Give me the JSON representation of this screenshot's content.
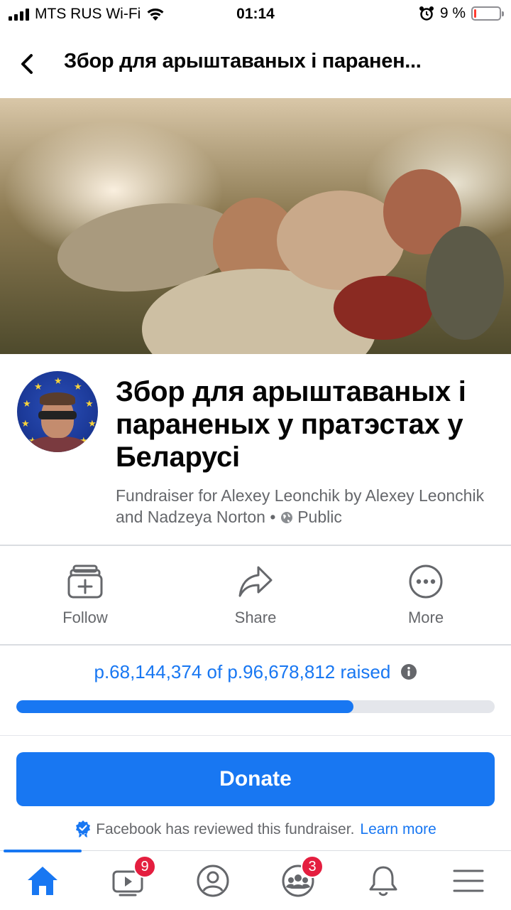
{
  "status_bar": {
    "carrier": "MTS RUS Wi-Fi",
    "time": "01:14",
    "battery_text": "9 %",
    "battery_level": 0.09
  },
  "header": {
    "title": "Збор для арыштаваных і паранен..."
  },
  "fundraiser": {
    "title": "Збор для арыштаваных і параненых у пратэстах у Беларусі",
    "subtitle": "Fundraiser for Alexey Leonchik by Alexey Leonchik and Nadzeya Norton •",
    "privacy": "Public"
  },
  "actions": {
    "follow": "Follow",
    "share": "Share",
    "more": "More"
  },
  "progress": {
    "raised_text": "р.68,144,374 of р.96,678,812 raised",
    "raised_amount": 68144374,
    "goal_amount": 96678812,
    "fraction": 0.7049
  },
  "donate": {
    "button_label": "Donate",
    "reviewed_text": "Facebook has reviewed this fundraiser.",
    "learn_more": "Learn more"
  },
  "tabbar": {
    "items": [
      {
        "icon": "home-icon",
        "active": true
      },
      {
        "icon": "watch-icon",
        "badge": "9"
      },
      {
        "icon": "profile-icon"
      },
      {
        "icon": "groups-icon",
        "badge": "3"
      },
      {
        "icon": "bell-icon"
      },
      {
        "icon": "menu-icon"
      }
    ]
  },
  "colors": {
    "accent": "#1877f2",
    "badge": "#e41e3f",
    "secondary_text": "#65676b"
  }
}
